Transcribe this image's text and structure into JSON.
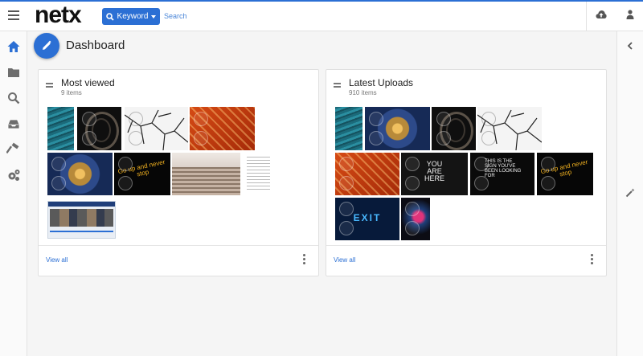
{
  "app": {
    "logo": "netx",
    "search": {
      "scope_label": "Keyword",
      "placeholder": "Search"
    }
  },
  "dashboard": {
    "title": "Dashboard"
  },
  "cards": {
    "most_viewed": {
      "title": "Most viewed",
      "count": "9 items",
      "view_all": "View all"
    },
    "latest_uploads": {
      "title": "Latest Uploads",
      "count": "910 items",
      "view_all": "View all"
    }
  },
  "thumb_text": {
    "go_up": "Go up and never stop",
    "you_are_here": "YOU\nARE\nHERE",
    "exit": "EXIT",
    "neon_quote": "THIS IS THE SIGN YOU'VE BEEN LOOKING FOR"
  },
  "colors": {
    "accent": "#2b6fd4"
  },
  "icons": {
    "nav": [
      "home-icon",
      "folder-icon",
      "search-icon",
      "inbox-icon",
      "hammer-icon",
      "settings-gears-icon"
    ],
    "top_right": [
      "upload-cloud-icon",
      "user-icon"
    ],
    "right_nav": [
      "chevron-left-icon",
      "magic-wand-icon"
    ]
  }
}
